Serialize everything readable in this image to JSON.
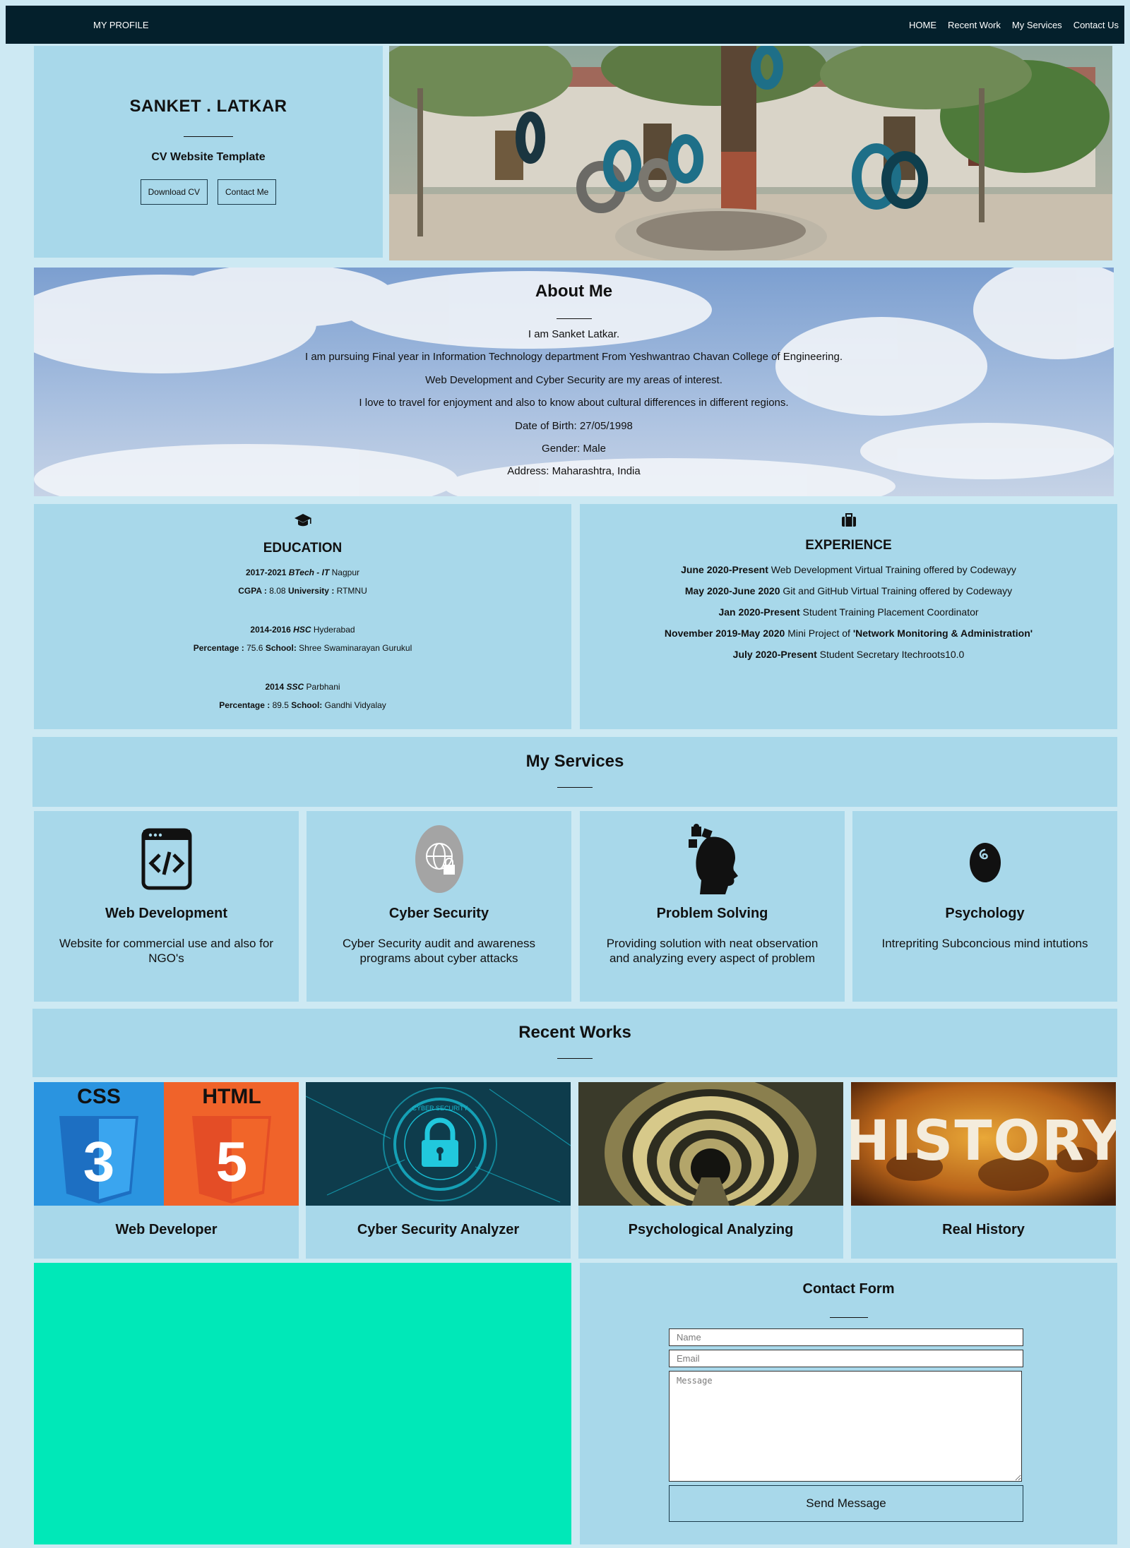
{
  "nav": {
    "brand": "MY PROFILE",
    "links": [
      "HOME",
      "Recent Work",
      "My Services",
      "Contact Us"
    ]
  },
  "hero": {
    "name": "SANKET . LATKAR",
    "subtitle": "CV Website Template",
    "download_label": "Download CV",
    "contact_label": "Contact Me"
  },
  "about": {
    "title": "About Me",
    "lines": [
      "I am Sanket Latkar.",
      "I am pursuing Final year in Information Technology department From Yeshwantrao Chavan College of Engineering.",
      "Web Development and Cyber Security are my areas of interest.",
      "I love to travel for enjoyment and also to know about cultural differences in different regions.",
      "Date of Birth: 27/05/1998",
      "Gender: Male",
      "Address: Maharashtra, India"
    ]
  },
  "education": {
    "title": "EDUCATION",
    "icon": "graduation-cap-icon",
    "entries": [
      {
        "years": "2017-2021",
        "degree": "BTech - IT",
        "place": "Nagpur",
        "score_label": "CGPA :",
        "score": "8.08",
        "inst_label": "University :",
        "inst": "RTMNU"
      },
      {
        "years": "2014-2016",
        "degree": "HSC",
        "place": "Hyderabad",
        "score_label": "Percentage :",
        "score": "75.6",
        "inst_label": "School:",
        "inst": "Shree Swaminarayan Gurukul"
      },
      {
        "years": "2014",
        "degree": "SSC",
        "place": "Parbhani",
        "score_label": "Percentage :",
        "score": "89.5",
        "inst_label": "School:",
        "inst": "Gandhi Vidyalay"
      }
    ]
  },
  "experience": {
    "title": "EXPERIENCE",
    "icon": "briefcase-icon",
    "entries": [
      {
        "period": "June 2020-Present",
        "text": "Web Development Virtual Training offered by Codewayy",
        "extra": ""
      },
      {
        "period": "May 2020-June 2020",
        "text": "Git and GitHub Virtual Training offered by Codewayy",
        "extra": ""
      },
      {
        "period": "Jan 2020-Present",
        "text": "Student Training Placement Coordinator",
        "extra": ""
      },
      {
        "period": "November 2019-May 2020",
        "text": "Mini Project of",
        "extra": "'Network Monitoring & Administration'"
      },
      {
        "period": "July 2020-Present",
        "text": "Student Secretary Itechroots10.0",
        "extra": ""
      }
    ]
  },
  "services": {
    "title": "My Services",
    "items": [
      {
        "title": "Web Development",
        "desc": "Website for commercial use and also for NGO's",
        "icon": "code-window-icon"
      },
      {
        "title": "Cyber Security",
        "desc": "Cyber Security audit and awareness programs about cyber attacks",
        "icon": "globe-lock-icon"
      },
      {
        "title": "Problem Solving",
        "desc": "Providing solution with neat observation and analyzing every aspect of problem",
        "icon": "puzzle-head-icon"
      },
      {
        "title": "Psychology",
        "desc": "Intrepriting Subconcious mind intutions",
        "icon": "spiral-egg-icon"
      }
    ]
  },
  "works": {
    "title": "Recent Works",
    "items": [
      {
        "title": "Web Developer",
        "thumb_text_1": "CSS",
        "thumb_text_2": "HTML"
      },
      {
        "title": "Cyber Security Analyzer",
        "thumb_text_1": "CYBER SECURITY",
        "thumb_text_2": ""
      },
      {
        "title": "Psychological Analyzing",
        "thumb_text_1": "",
        "thumb_text_2": ""
      },
      {
        "title": "Real History",
        "thumb_text_1": "HISTORY",
        "thumb_text_2": ""
      }
    ]
  },
  "contact": {
    "title": "Contact Form",
    "name_placeholder": "Name",
    "email_placeholder": "Email",
    "message_placeholder": "Message",
    "send_label": "Send Message"
  },
  "colors": {
    "page_bg": "#cde9f3",
    "panel": "#a8d8ea",
    "nav": "#04202c",
    "teal_block": "#00e8b8"
  }
}
